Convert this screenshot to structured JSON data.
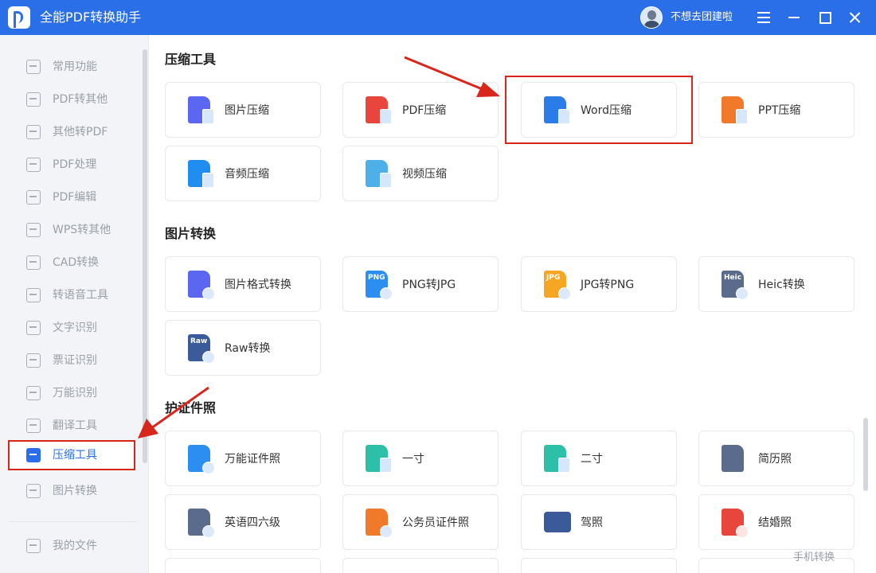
{
  "window": {
    "app_title": "全能PDF转换助手",
    "username": "不想去团建啦",
    "titlebar_color": "#2b6fe8"
  },
  "sidebar": {
    "items": [
      {
        "label": "常用功能",
        "icon": "home-grid-icon"
      },
      {
        "label": "PDF转其他",
        "icon": "pdf-export-icon"
      },
      {
        "label": "其他转PDF",
        "icon": "pdf-import-icon"
      },
      {
        "label": "PDF处理",
        "icon": "pdf-process-icon"
      },
      {
        "label": "PDF编辑",
        "icon": "pdf-edit-icon"
      },
      {
        "label": "WPS转其他",
        "icon": "wps-icon"
      },
      {
        "label": "CAD转换",
        "icon": "cad-icon"
      },
      {
        "label": "转语音工具",
        "icon": "text-to-speech-icon"
      },
      {
        "label": "文字识别",
        "icon": "ocr-icon"
      },
      {
        "label": "票证识别",
        "icon": "ticket-icon"
      },
      {
        "label": "万能识别",
        "icon": "eye-scan-icon"
      },
      {
        "label": "翻译工具",
        "icon": "translate-icon"
      },
      {
        "label": "压缩工具",
        "icon": "zip-icon",
        "active": true
      },
      {
        "label": "图片转换",
        "icon": "image-convert-icon"
      }
    ],
    "my_files": "我的文件"
  },
  "sections": {
    "compress": {
      "title": "压缩工具",
      "cards": [
        {
          "label": "图片压缩",
          "icon": "image-compress-icon",
          "color": "#5b67f0"
        },
        {
          "label": "PDF压缩",
          "icon": "pdf-compress-icon",
          "color": "#e8453c"
        },
        {
          "label": "Word压缩",
          "icon": "word-compress-icon",
          "color": "#2b7be8"
        },
        {
          "label": "PPT压缩",
          "icon": "ppt-compress-icon",
          "color": "#f07a2a"
        },
        {
          "label": "音频压缩",
          "icon": "audio-compress-icon",
          "color": "#1f8ef0"
        },
        {
          "label": "视频压缩",
          "icon": "video-compress-icon",
          "color": "#4db0e8"
        }
      ]
    },
    "image_convert": {
      "title": "图片转换",
      "cards": [
        {
          "label": "图片格式转换",
          "icon": "image-format-icon",
          "color": "#5b67f0",
          "badge_text": ""
        },
        {
          "label": "PNG转JPG",
          "icon": "png-icon",
          "color": "#2b8ef0",
          "badge_text": "PNG"
        },
        {
          "label": "JPG转PNG",
          "icon": "jpg-icon",
          "color": "#f5a623",
          "badge_text": "JPG"
        },
        {
          "label": "Heic转换",
          "icon": "heic-icon",
          "color": "#5a6b8c",
          "badge_text": "Heic"
        },
        {
          "label": "Raw转换",
          "icon": "raw-icon",
          "color": "#3b5a99",
          "badge_text": "Raw"
        }
      ]
    },
    "id_photo": {
      "title": "护证件照",
      "cards": [
        {
          "label": "万能证件照",
          "icon": "id-photo-icon",
          "color": "#2b8ef0"
        },
        {
          "label": "一寸",
          "icon": "one-inch-icon",
          "color": "#2cc0a8"
        },
        {
          "label": "二寸",
          "icon": "two-inch-icon",
          "color": "#2cc0a8"
        },
        {
          "label": "简历照",
          "icon": "resume-icon",
          "color": "#5a6b8c"
        },
        {
          "label": "英语四六级",
          "icon": "english-exam-icon",
          "color": "#5a6b8c"
        },
        {
          "label": "公务员证件照",
          "icon": "civil-servant-icon",
          "color": "#f07a2a"
        },
        {
          "label": "驾照",
          "icon": "driver-license-icon",
          "color": "#3b5a99"
        },
        {
          "label": "结婚照",
          "icon": "marriage-icon",
          "color": "#e8453c"
        }
      ]
    }
  },
  "footer": {
    "mobile_convert": "手机转换"
  },
  "annotation": {
    "highlight_color": "#d9261c"
  }
}
